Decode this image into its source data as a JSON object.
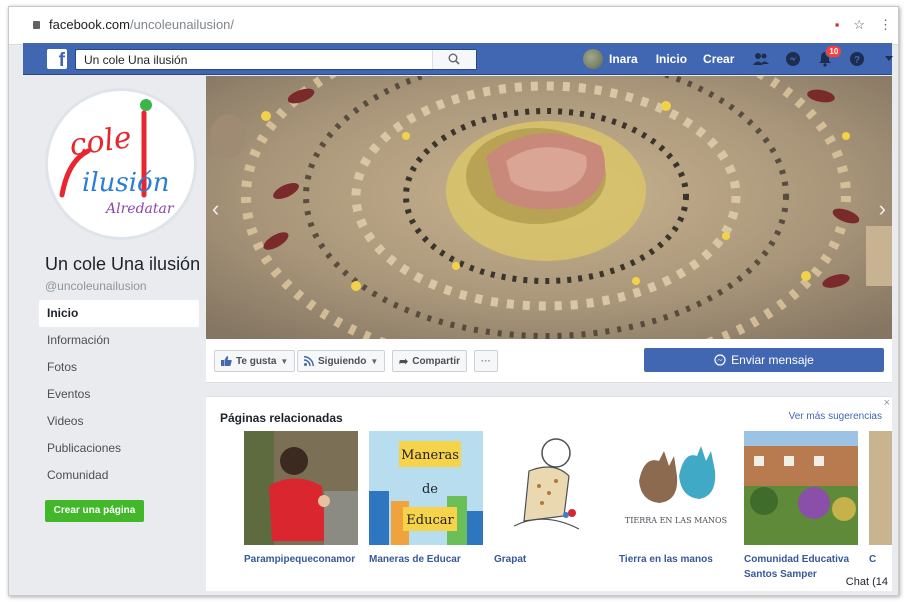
{
  "browser": {
    "url_host": "facebook.com",
    "url_path": "/uncoleunailusion/"
  },
  "topbar": {
    "search_value": "Un cole Una ilusión",
    "user_name": "Inara",
    "nav_home": "Inicio",
    "nav_create": "Crear",
    "notifications_count": "10"
  },
  "page": {
    "name": "Un cole Una ilusión",
    "handle": "@uncoleunailusion",
    "logo_text": [
      "cole",
      "ilusión",
      "Alredatar"
    ]
  },
  "menu": {
    "items": [
      {
        "label": "Inicio"
      },
      {
        "label": "Información"
      },
      {
        "label": "Fotos"
      },
      {
        "label": "Eventos"
      },
      {
        "label": "Videos"
      },
      {
        "label": "Publicaciones"
      },
      {
        "label": "Comunidad"
      }
    ],
    "create_page": "Crear una página"
  },
  "actions": {
    "like": "Te gusta",
    "following": "Siguiendo",
    "share": "Compartir",
    "more": "···",
    "message": "Enviar mensaje"
  },
  "related": {
    "title": "Páginas relacionadas",
    "see_more": "Ver más sugerencias",
    "close": "×",
    "pages": [
      {
        "name": "Parampipequeconamor"
      },
      {
        "name": "Maneras de Educar",
        "image_text": [
          "Maneras",
          "de",
          "Educar"
        ]
      },
      {
        "name": "Grapat"
      },
      {
        "name": "Tierra en las manos",
        "image_text": "TIERRA EN LAS MANOS"
      },
      {
        "name": "Comunidad Educativa Santos Samper"
      },
      {
        "name": "C"
      }
    ]
  },
  "chat": {
    "label": "Chat (14"
  },
  "colors": {
    "facebook_blue": "#4267b2",
    "create_green": "#42b72a",
    "link_blue": "#385898",
    "badge_red": "#fa3e3e"
  },
  "icons": [
    "lock-icon",
    "facebook-logo-icon",
    "search-icon",
    "friends-icon",
    "messenger-icon",
    "bell-icon",
    "help-icon",
    "caret-down-icon",
    "thumbs-up-icon",
    "rss-icon",
    "share-arrow-icon",
    "messenger-icon",
    "chevron-left-icon",
    "chevron-right-icon",
    "close-icon"
  ]
}
